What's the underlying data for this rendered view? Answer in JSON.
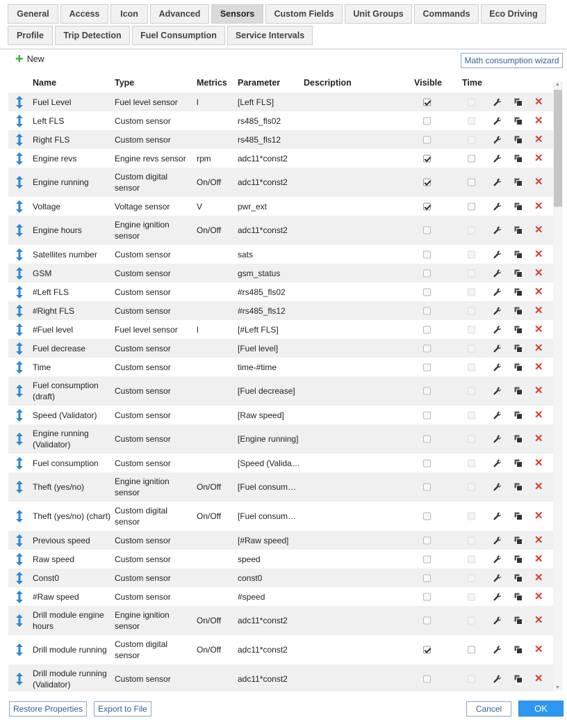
{
  "tabs": [
    "General",
    "Access",
    "Icon",
    "Advanced",
    "Sensors",
    "Custom Fields",
    "Unit Groups",
    "Commands",
    "Eco Driving",
    "Profile",
    "Trip Detection",
    "Fuel Consumption",
    "Service Intervals"
  ],
  "active_tab": "Sensors",
  "toolbar": {
    "new_label": "New",
    "wizard_label": "Math consumption wizard"
  },
  "columns": {
    "name": "Name",
    "type": "Type",
    "metrics": "Metrics",
    "parameter": "Parameter",
    "description": "Description",
    "visible": "Visible",
    "time": "Time"
  },
  "sensors": [
    {
      "name": "Fuel Level",
      "type": "Fuel level sensor",
      "metrics": "l",
      "parameter": "[Left FLS]",
      "visible": true,
      "time": "disabled"
    },
    {
      "name": "Left FLS",
      "type": "Custom sensor",
      "metrics": "",
      "parameter": "rs485_fls02",
      "visible": false,
      "time": "disabled"
    },
    {
      "name": "Right FLS",
      "type": "Custom sensor",
      "metrics": "",
      "parameter": "rs485_fls12",
      "visible": false,
      "time": "disabled"
    },
    {
      "name": "Engine revs",
      "type": "Engine revs sensor",
      "metrics": "rpm",
      "parameter": "adc11*const2",
      "visible": true,
      "time": "off"
    },
    {
      "name": "Engine running",
      "type": "Custom digital sensor",
      "metrics": "On/Off",
      "parameter": "adc11*const2",
      "visible": true,
      "time": "off"
    },
    {
      "name": "Voltage",
      "type": "Voltage sensor",
      "metrics": "V",
      "parameter": "pwr_ext",
      "visible": true,
      "time": "off"
    },
    {
      "name": "Engine hours",
      "type": "Engine ignition sensor",
      "metrics": "On/Off",
      "parameter": "adc11*const2",
      "visible": false,
      "time": "disabled"
    },
    {
      "name": "Satellites number",
      "type": "Custom sensor",
      "metrics": "",
      "parameter": "sats",
      "visible": false,
      "time": "disabled"
    },
    {
      "name": "GSM",
      "type": "Custom sensor",
      "metrics": "",
      "parameter": "gsm_status",
      "visible": false,
      "time": "disabled"
    },
    {
      "name": "#Left FLS",
      "type": "Custom sensor",
      "metrics": "",
      "parameter": "#rs485_fls02",
      "visible": false,
      "time": "disabled"
    },
    {
      "name": "#Right FLS",
      "type": "Custom sensor",
      "metrics": "",
      "parameter": "#rs485_fls12",
      "visible": false,
      "time": "disabled"
    },
    {
      "name": "#Fuel level",
      "type": "Fuel level sensor",
      "metrics": "l",
      "parameter": "[#Left FLS]",
      "visible": false,
      "time": "disabled"
    },
    {
      "name": "Fuel decrease",
      "type": "Custom sensor",
      "metrics": "",
      "parameter": "[Fuel level]",
      "visible": false,
      "time": "disabled"
    },
    {
      "name": "Time",
      "type": "Custom sensor",
      "metrics": "",
      "parameter": "time-#time",
      "visible": false,
      "time": "disabled"
    },
    {
      "name": "Fuel consumption (draft)",
      "type": "Custom sensor",
      "metrics": "",
      "parameter": "[Fuel decrease]",
      "visible": false,
      "time": "disabled"
    },
    {
      "name": "Speed (Validator)",
      "type": "Custom sensor",
      "metrics": "",
      "parameter": "[Raw speed]",
      "visible": false,
      "time": "disabled"
    },
    {
      "name": "Engine running (Validator)",
      "type": "Custom sensor",
      "metrics": "",
      "parameter": "[Engine running]",
      "visible": false,
      "time": "disabled"
    },
    {
      "name": "Fuel consumption",
      "type": "Custom sensor",
      "metrics": "",
      "parameter": "[Speed (Validator)]",
      "visible": false,
      "time": "disabled"
    },
    {
      "name": "Theft (yes/no)",
      "type": "Engine ignition sensor",
      "metrics": "On/Off",
      "parameter": "[Fuel consumption]",
      "visible": false,
      "time": "disabled"
    },
    {
      "name": "Theft (yes/no) (chart)",
      "type": "Custom digital sensor",
      "metrics": "On/Off",
      "parameter": "[Fuel consumption]",
      "visible": false,
      "time": "disabled"
    },
    {
      "name": "Previous speed",
      "type": "Custom sensor",
      "metrics": "",
      "parameter": "[#Raw speed]",
      "visible": false,
      "time": "disabled"
    },
    {
      "name": "Raw speed",
      "type": "Custom sensor",
      "metrics": "",
      "parameter": "speed",
      "visible": false,
      "time": "disabled"
    },
    {
      "name": "Const0",
      "type": "Custom sensor",
      "metrics": "",
      "parameter": "const0",
      "visible": false,
      "time": "disabled"
    },
    {
      "name": "#Raw speed",
      "type": "Custom sensor",
      "metrics": "",
      "parameter": "#speed",
      "visible": false,
      "time": "disabled"
    },
    {
      "name": "Drill module engine hours",
      "type": "Engine ignition sensor",
      "metrics": "On/Off",
      "parameter": "adc11*const2",
      "visible": false,
      "time": "disabled"
    },
    {
      "name": "Drill module running",
      "type": "Custom digital sensor",
      "metrics": "On/Off",
      "parameter": "adc11*const2",
      "visible": true,
      "time": "off"
    },
    {
      "name": "Drill module running (Validator)",
      "type": "Custom sensor",
      "metrics": "",
      "parameter": "adc11*const2",
      "visible": false,
      "time": "disabled"
    }
  ],
  "footer": {
    "restore_label": "Restore Properties",
    "export_label": "Export to File",
    "cancel_label": "Cancel",
    "ok_label": "OK"
  },
  "colors": {
    "accent": "#2e97f0",
    "delete": "#e03a2e",
    "add": "#3aa935",
    "drag": "#2a86d8"
  }
}
